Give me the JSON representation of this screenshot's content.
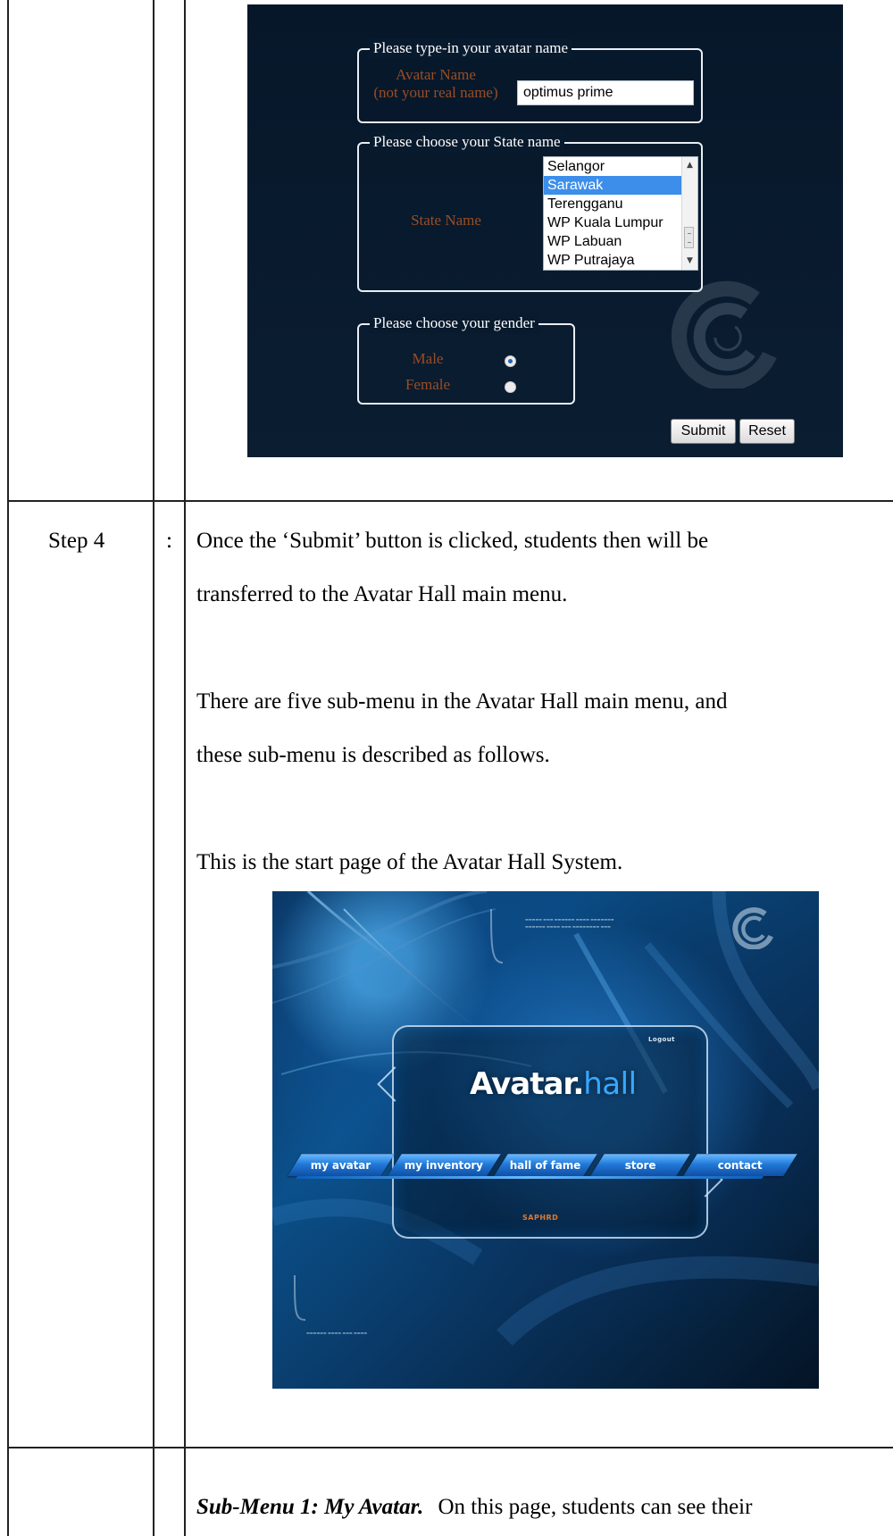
{
  "form_screenshot": {
    "avatar_fieldset": {
      "legend": "Please type-in your avatar name",
      "label_line1": "Avatar Name",
      "label_line2": "(not your real name)",
      "input_value": "optimus prime"
    },
    "state_fieldset": {
      "legend": "Please choose your State name",
      "label": "State Name",
      "options": [
        "Selangor",
        "Sarawak",
        "Terengganu",
        "WP Kuala Lumpur",
        "WP Labuan",
        "WP Putrajaya"
      ],
      "selected": "Sarawak"
    },
    "gender_fieldset": {
      "legend": "Please choose your gender",
      "male_label": "Male",
      "female_label": "Female",
      "selected": "Male"
    },
    "submit_label": "Submit",
    "reset_label": "Reset",
    "accent_color": "#9a4d24",
    "logo_icon": "swirl-logo-icon"
  },
  "step": {
    "label": "Step 4",
    "colon": ":",
    "paragraph1_line1": "Once the ‘Submit’ button is clicked, students then will be",
    "paragraph1_line2": "transferred to the Avatar Hall main menu.",
    "paragraph2_line1": "There are five sub-menu in the Avatar Hall main menu, and",
    "paragraph2_line2": "these sub-menu is described as follows.",
    "paragraph3": "This is the start page of the Avatar Hall System."
  },
  "hall_screenshot": {
    "logout": "Logout",
    "title_part1": "Avatar.",
    "title_part2": "hall",
    "menu": [
      "my avatar",
      "my inventory",
      "hall of fame",
      "store",
      "contact"
    ],
    "footer_label": "SAPHRD",
    "brand_color": "#37a8ff",
    "logo_icon": "swirl-logo-icon"
  },
  "sub_menu": {
    "title": "Sub-Menu 1: My Avatar.",
    "text": "On this page, students can see their"
  }
}
